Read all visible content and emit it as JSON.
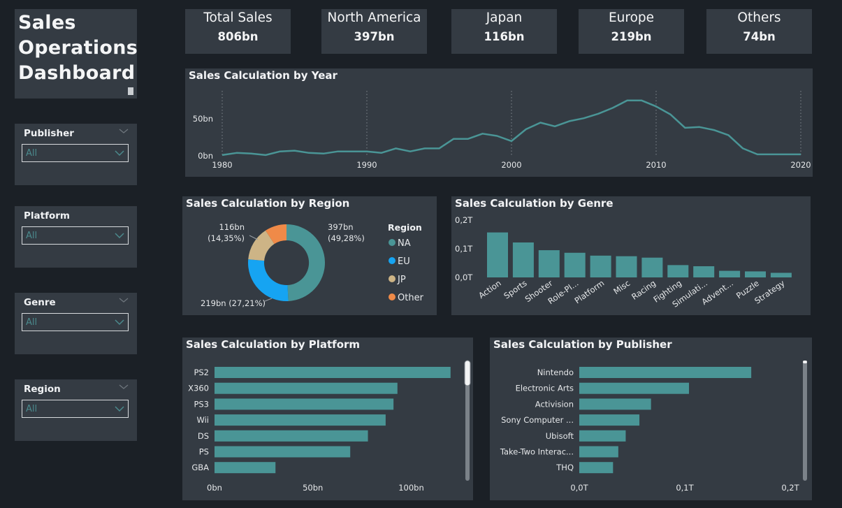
{
  "dashboard": {
    "title": "Sales\nOperations\nDashboard"
  },
  "kpis": [
    {
      "label": "Total Sales",
      "value": "806bn"
    },
    {
      "label": "North America",
      "value": "397bn"
    },
    {
      "label": "Japan",
      "value": "116bn"
    },
    {
      "label": "Europe",
      "value": "219bn"
    },
    {
      "label": "Others",
      "value": "74bn"
    }
  ],
  "slicers": [
    {
      "label": "Publisher",
      "value": "All"
    },
    {
      "label": "Platform",
      "value": "All"
    },
    {
      "label": "Genre",
      "value": "All"
    },
    {
      "label": "Region",
      "value": "All"
    }
  ],
  "colors": {
    "teal": "#4a9596",
    "na": "#4a9596",
    "eu": "#16a4f2",
    "jp": "#cdb486",
    "other": "#ef8a48"
  },
  "chart_data": [
    {
      "type": "line",
      "title": "Sales Calculation by Year",
      "x": [
        1980,
        1981,
        1982,
        1983,
        1984,
        1985,
        1986,
        1987,
        1988,
        1989,
        1990,
        1991,
        1992,
        1993,
        1994,
        1995,
        1996,
        1997,
        1998,
        1999,
        2000,
        2001,
        2002,
        2003,
        2004,
        2005,
        2006,
        2007,
        2008,
        2009,
        2010,
        2011,
        2012,
        2013,
        2014,
        2015,
        2016,
        2017,
        2018,
        2019,
        2020
      ],
      "y": [
        1,
        4,
        3,
        1,
        6,
        7,
        4,
        3,
        6,
        6,
        6,
        4,
        10,
        6,
        10,
        10,
        23,
        23,
        30,
        27,
        20,
        36,
        45,
        40,
        47,
        51,
        57,
        65,
        75,
        75,
        67,
        56,
        38,
        39,
        35,
        28,
        10,
        2,
        2,
        2,
        2
      ],
      "x_ticks": [
        "1980",
        "1990",
        "2000",
        "2010",
        "2020"
      ],
      "y_ticks": [
        "0bn",
        "50bn"
      ],
      "ylim": [
        0,
        90
      ]
    },
    {
      "type": "pie",
      "title": "Sales Calculation by Region",
      "legend_title": "Region",
      "slices": [
        {
          "name": "NA",
          "value": 397,
          "label": "397bn",
          "pct": "(49,28%)"
        },
        {
          "name": "EU",
          "value": 219,
          "label": "219bn (27,21%)",
          "pct": ""
        },
        {
          "name": "JP",
          "value": 116,
          "label": "116bn",
          "pct": "(14,35%)"
        },
        {
          "name": "Other",
          "value": 74,
          "label": "",
          "pct": ""
        }
      ]
    },
    {
      "type": "bar",
      "title": "Sales Calculation by Genre",
      "categories": [
        "Action",
        "Sports",
        "Shooter",
        "Role-Pl...",
        "Platform",
        "Misc",
        "Racing",
        "Fighting",
        "Simulati...",
        "Advent...",
        "Puzzle",
        "Strategy"
      ],
      "values": [
        0.157,
        0.122,
        0.095,
        0.086,
        0.076,
        0.074,
        0.069,
        0.043,
        0.039,
        0.023,
        0.021,
        0.016
      ],
      "y_ticks": [
        "0,0T",
        "0,1T",
        "0,2T"
      ],
      "ylim": [
        0,
        0.2
      ]
    },
    {
      "type": "bar",
      "title": "Sales Calculation by Platform",
      "categories": [
        "PS2",
        "X360",
        "PS3",
        "Wii",
        "DS",
        "PS",
        "GBA"
      ],
      "values": [
        120,
        93,
        91,
        87,
        78,
        69,
        31
      ],
      "x_ticks": [
        "0bn",
        "50bn",
        "100bn"
      ],
      "xlim": [
        0,
        135
      ]
    },
    {
      "type": "bar",
      "title": "Sales Calculation by Publisher",
      "categories": [
        "Nintendo",
        "Electronic Arts",
        "Activision",
        "Sony Computer ...",
        "Ubisoft",
        "Take-Two Interac...",
        "THQ"
      ],
      "values": [
        0.163,
        0.104,
        0.068,
        0.057,
        0.044,
        0.037,
        0.032
      ],
      "x_ticks": [
        "0,0T",
        "0,1T",
        "0,2T"
      ],
      "xlim": [
        0,
        0.2
      ]
    }
  ]
}
